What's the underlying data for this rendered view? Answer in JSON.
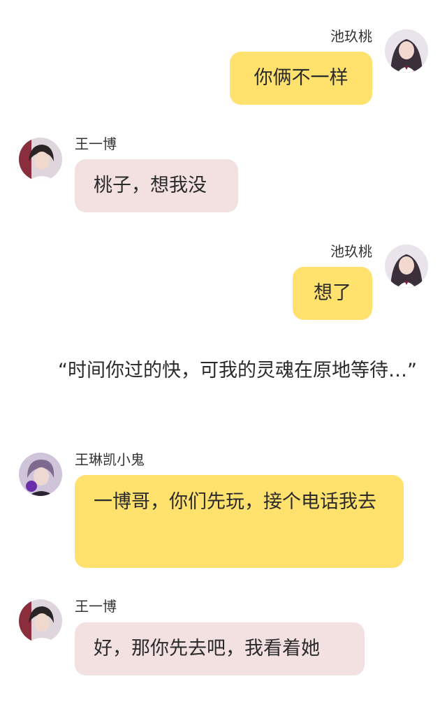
{
  "messages": [
    {
      "sender": "池玖桃",
      "text": "你俩不一样",
      "side": "right",
      "avatar_icon": "avatar-chi-jiutao-icon"
    },
    {
      "sender": "王一博",
      "text": "桃子，想我没",
      "side": "left",
      "avatar_icon": "avatar-wang-yibo-icon"
    },
    {
      "sender": "池玖桃",
      "text": "想了",
      "side": "right",
      "avatar_icon": "avatar-chi-jiutao-icon"
    },
    {
      "sender": "王琳凯小鬼",
      "text": "一博哥，你们先玩，接个电话我去",
      "side": "left",
      "avatar_icon": "avatar-wang-linkai-icon"
    },
    {
      "sender": "王一博",
      "text": "好，那你先去吧，我看着她",
      "side": "left",
      "avatar_icon": "avatar-wang-yibo-icon"
    }
  ],
  "narration": "“时间你过的快，可我的灵魂在原地等待…”",
  "colors": {
    "bubble_yellow": "#ffe16e",
    "bubble_pink": "#f3e1e1",
    "name_text": "#333333"
  }
}
